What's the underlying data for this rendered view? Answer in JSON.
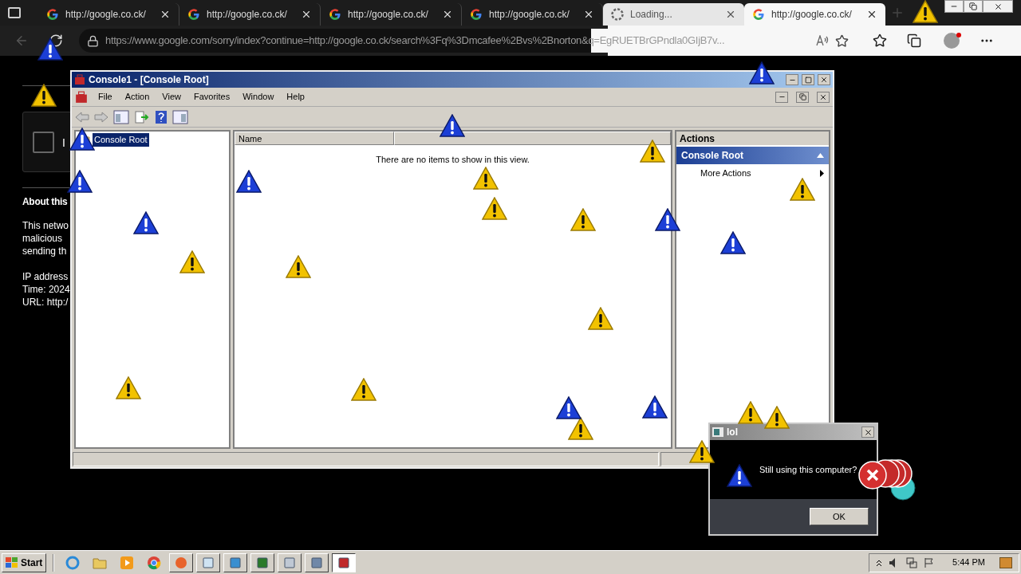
{
  "browser": {
    "tabs": [
      {
        "title": "http://google.co.ck/",
        "kind": "page",
        "selected": false
      },
      {
        "title": "http://google.co.ck/",
        "kind": "page",
        "selected": false
      },
      {
        "title": "http://google.co.ck/",
        "kind": "page",
        "selected": false
      },
      {
        "title": "http://google.co.ck/",
        "kind": "page",
        "selected": false
      },
      {
        "title": "Loading...",
        "kind": "loading",
        "selected": false
      },
      {
        "title": "http://google.co.ck/",
        "kind": "page",
        "selected": true
      }
    ],
    "address": "https://www.google.com/sorry/index?continue=http://google.co.ck/search%3Fq%3Dmcafee%2Bvs%2Bnorton&q=EgRUETBrGPndla0GIjB7v...",
    "page": {
      "checkbox_checked": false,
      "checkbox_label": "I",
      "heading": "About this",
      "paragraphs": [
        [
          "This netwo",
          "malicious",
          "sending th"
        ],
        [
          "IP address",
          "Time: 2024",
          "URL: http:/"
        ]
      ]
    }
  },
  "console": {
    "title": "Console1 - [Console Root]",
    "menu": [
      "File",
      "Action",
      "View",
      "Favorites",
      "Window",
      "Help"
    ],
    "tree": [
      {
        "label": "Console Root",
        "selected": true
      }
    ],
    "columns": [
      "Name"
    ],
    "empty_message": "There are no items to show in this view.",
    "actions": {
      "header": "Actions",
      "section": "Console Root",
      "items": [
        "More Actions"
      ]
    }
  },
  "dialog": {
    "title": "lol",
    "message": "Still using this computer?",
    "button": "OK"
  },
  "taskbar": {
    "start": "Start",
    "tasks": [
      {
        "selected": false
      },
      {
        "selected": false
      },
      {
        "selected": false
      },
      {
        "selected": false
      },
      {
        "selected": false
      },
      {
        "selected": false
      },
      {
        "selected": true
      }
    ],
    "clock": "5:44 PM"
  }
}
